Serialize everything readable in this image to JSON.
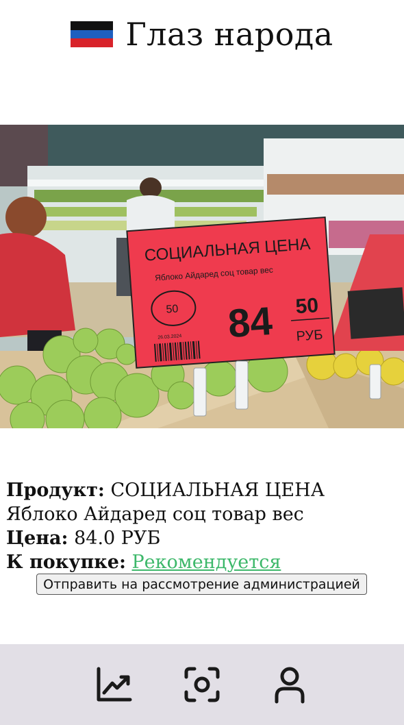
{
  "header": {
    "title": "Глаз народа",
    "flag_colors": [
      "#111111",
      "#1f5fbf",
      "#d8232a"
    ]
  },
  "photo": {
    "tag_headline": "СОЦИАЛЬНАЯ ЦЕНА",
    "tag_product": "Яблоко Айдаред соц товар вес",
    "tag_badge": "50",
    "tag_date": "26.03.2024",
    "tag_rubles": "84",
    "tag_kopecks": "50",
    "tag_currency": "РУБ",
    "tag_color": "#ef3b4e"
  },
  "product": {
    "product_label": "Продукт:",
    "product_value": " СОЦИАЛЬНАЯ ЦЕНА Яблоко Айдаред соц товар вес",
    "price_label": "Цена:",
    "price_value": " 84.0 РУБ",
    "purchase_label": "К покупке:",
    "purchase_value": "Рекомендуется",
    "purchase_color": "#3db86a"
  },
  "actions": {
    "submit_label": "Отправить на рассмотрение администрацией"
  },
  "nav": {
    "items": [
      {
        "icon": "chart-line-icon"
      },
      {
        "icon": "scan-icon"
      },
      {
        "icon": "user-icon"
      }
    ]
  }
}
